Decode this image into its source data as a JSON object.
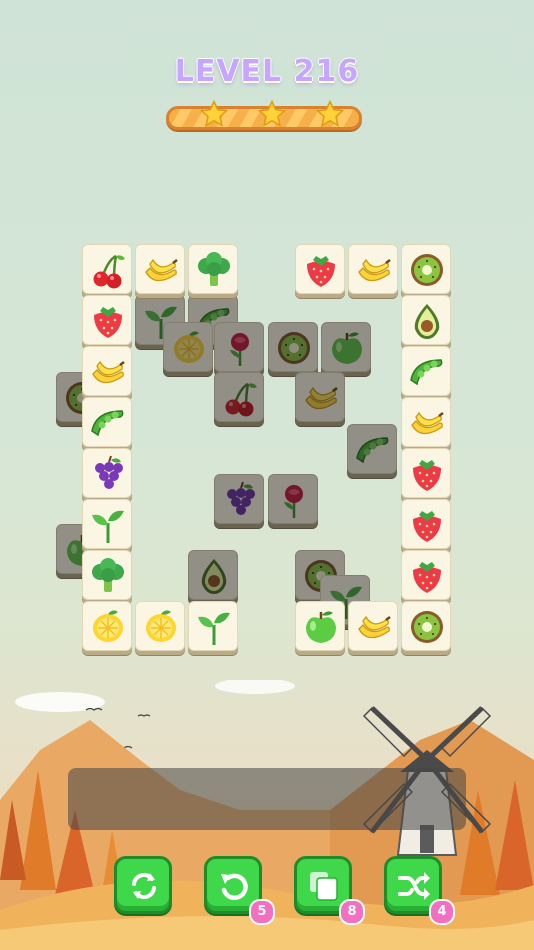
{
  "header": {
    "level_label": "LEVEL 216",
    "stars_earned": 3,
    "stars_total": 3
  },
  "colors": {
    "title": "#c7a6ff",
    "tile_face": "#fbf6e4",
    "button_green": "#3fd84a",
    "badge_pink": "#f36fbf"
  },
  "board": {
    "top_tiles": [
      "cherry",
      "banana",
      "broccoli",
      "strawberry",
      "banana",
      "kiwi",
      "strawberry",
      "avocado",
      "banana",
      "peapod",
      "peapod",
      "banana",
      "grapes",
      "strawberry",
      "sprout",
      "strawberry",
      "broccoli",
      "strawberry",
      "lemon",
      "lemon",
      "sprout",
      "apple",
      "banana",
      "kiwi"
    ],
    "hidden_tiles_visible": [
      "peapod",
      "sprout",
      "lemon",
      "rose",
      "kiwi",
      "apple",
      "kiwi",
      "cherry",
      "banana",
      "peapod",
      "grapes",
      "rose",
      "apple",
      "avocado",
      "kiwi",
      "sprout"
    ]
  },
  "toolbar": {
    "buttons": [
      {
        "name": "refresh",
        "icon": "refresh-icon",
        "count": ""
      },
      {
        "name": "undo",
        "icon": "undo-icon",
        "count": "5"
      },
      {
        "name": "cards",
        "icon": "cards-icon",
        "count": "8"
      },
      {
        "name": "shuffle",
        "icon": "shuffle-icon",
        "count": "4"
      }
    ]
  }
}
